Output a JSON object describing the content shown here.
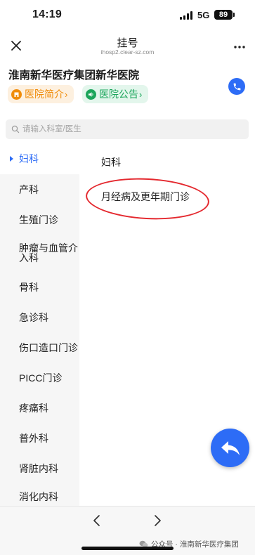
{
  "status_bar": {
    "time": "14:19",
    "network": "5G",
    "battery": "89"
  },
  "nav": {
    "title": "挂号",
    "url": "ihosp2.clear-sz.com"
  },
  "hospital": {
    "name": "淮南新华医疗集团新华医院",
    "intro_label": "医院简介",
    "notice_label": "医院公告"
  },
  "search": {
    "placeholder": "请输入科室/医生"
  },
  "departments": [
    {
      "label": "妇科",
      "active": true
    },
    {
      "label": "产科"
    },
    {
      "label": "生殖门诊"
    },
    {
      "label": "肿瘤与血管介入科"
    },
    {
      "label": "骨科"
    },
    {
      "label": "急诊科"
    },
    {
      "label": "伤口造口门诊"
    },
    {
      "label": "PICC门诊"
    },
    {
      "label": "疼痛科"
    },
    {
      "label": "普外科"
    },
    {
      "label": "肾脏内科"
    },
    {
      "label": "消化内科"
    }
  ],
  "clinic_panel": {
    "heading": "妇科",
    "items": [
      "月经病及更年期门诊"
    ]
  },
  "watermark": "公众号 · 淮南新华医疗集团",
  "colors": {
    "accent": "#2d6cf6",
    "intro_tag": "#f08c0a",
    "notice_tag": "#1aa55a",
    "annotation": "#e4282e"
  }
}
